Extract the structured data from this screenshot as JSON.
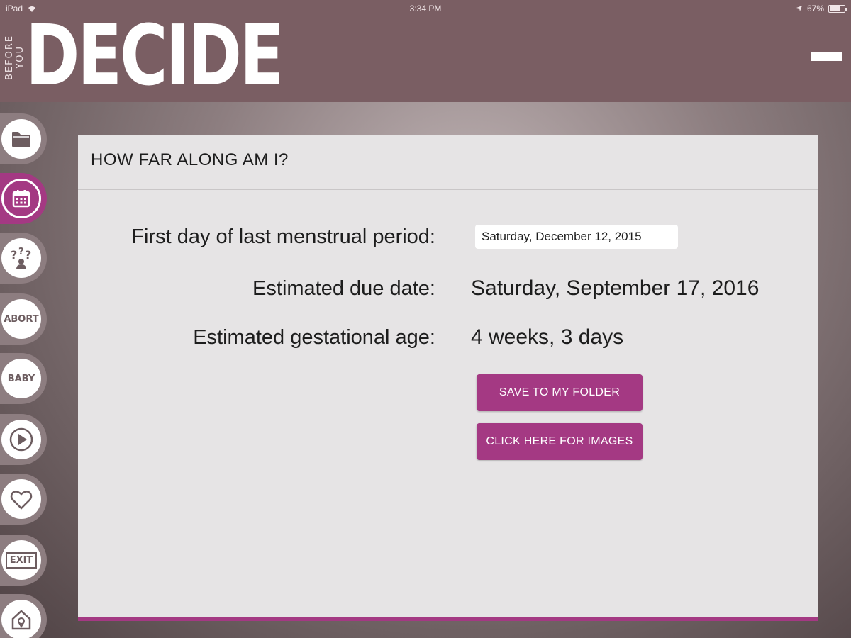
{
  "status_bar": {
    "device": "iPad",
    "time": "3:34 PM",
    "battery": "67%"
  },
  "header": {
    "brand_small": "BEFORE YOU",
    "brand_big": "DECIDE",
    "menu_icon": "menu-icon"
  },
  "sidebar": {
    "items": [
      {
        "icon": "folder-icon",
        "label": ""
      },
      {
        "icon": "calendar-icon",
        "label": "",
        "active": true
      },
      {
        "icon": "questions-icon",
        "label": ""
      },
      {
        "icon": "abort-icon",
        "label": "ABORT"
      },
      {
        "icon": "baby-icon",
        "label": "BABY"
      },
      {
        "icon": "play-icon",
        "label": ""
      },
      {
        "icon": "heart-icon",
        "label": ""
      },
      {
        "icon": "exit-icon",
        "label": "EXIT"
      },
      {
        "icon": "home-location-icon",
        "label": ""
      }
    ]
  },
  "card": {
    "title": "HOW FAR ALONG AM I?",
    "lmp_label": "First day of last menstrual period:",
    "lmp_value": "Saturday, December 12, 2015",
    "due_label": "Estimated due date:",
    "due_value": "Saturday, September 17, 2016",
    "age_label": "Estimated gestational age:",
    "age_value": "4 weeks, 3 days",
    "save_button": "SAVE TO MY FOLDER",
    "images_button": "CLICK HERE FOR IMAGES"
  },
  "colors": {
    "accent": "#a43983",
    "header": "#7a5e63",
    "card": "#e6e4e5"
  }
}
